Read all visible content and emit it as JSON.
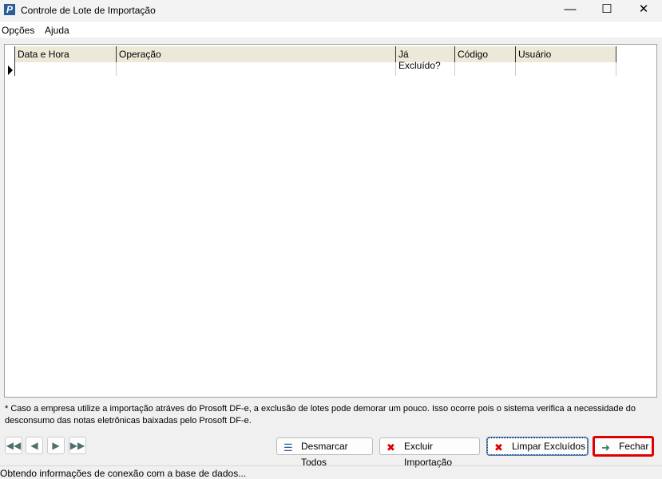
{
  "window": {
    "title": "Controle de Lote de Importação",
    "app_icon": "P"
  },
  "menu": [
    "Opções",
    "Ajuda"
  ],
  "table": {
    "columns": [
      "Data e Hora",
      "Operação",
      "Já Excluído?",
      "Código",
      "Usuário"
    ],
    "rows": []
  },
  "note": "* Caso a empresa utilize a importação atráves do Prosoft DF-e, a exclusão de lotes pode demorar um pouco. Isso ocorre pois o sistema verifica a necessidade do desconsumo das notas eletrônicas baixadas pelo  Prosoft DF-e.",
  "buttons": {
    "desmarcar": "Desmarcar Todos",
    "excluir": "Excluir Importação",
    "limpar": "Limpar Excluídos",
    "fechar": "Fechar"
  },
  "status": "Obtendo informações de conexão com a base de dados...",
  "colors": {
    "highlight": "#e00000"
  }
}
